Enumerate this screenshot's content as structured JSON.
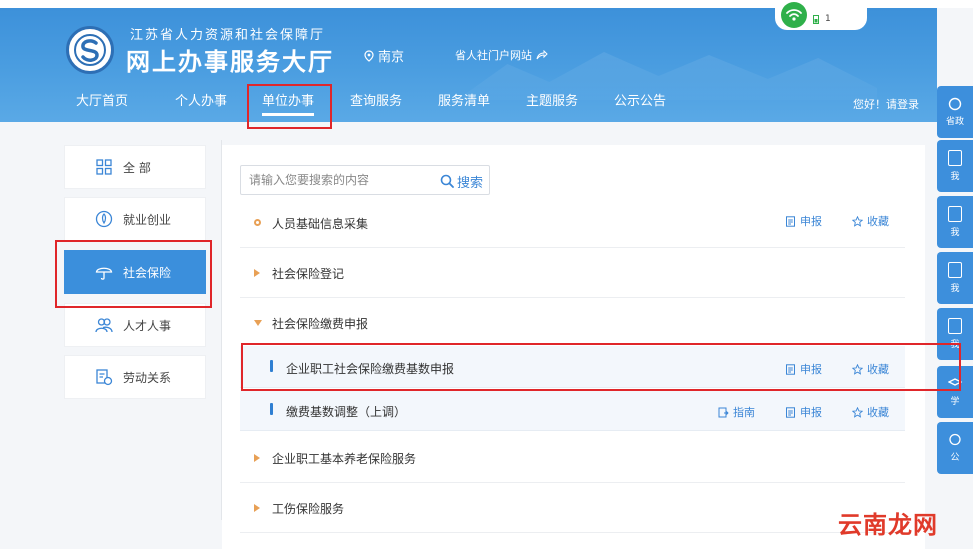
{
  "header": {
    "org_name": "江苏省人力资源和社会保障厅",
    "hall_name": "网上办事服务大厅",
    "city": "南京",
    "portal_link": "省人社门户网站",
    "signal_count": "1",
    "login_text": "您好！请登录"
  },
  "nav": {
    "items": [
      "大厅首页",
      "个人办事",
      "单位办事",
      "查询服务",
      "服务清单",
      "主题服务",
      "公示公告"
    ],
    "active_index": 2
  },
  "rightbar": {
    "items": [
      "省政",
      "我",
      "我",
      "我",
      "我",
      "学",
      "公"
    ]
  },
  "sidebar": {
    "items": [
      {
        "label": "全 部",
        "icon": "grid-icon"
      },
      {
        "label": "就业创业",
        "icon": "rocket-icon"
      },
      {
        "label": "社会保险",
        "icon": "umbrella-icon"
      },
      {
        "label": "人才人事",
        "icon": "people-icon"
      },
      {
        "label": "劳动关系",
        "icon": "contract-icon"
      }
    ],
    "active_index": 2
  },
  "search": {
    "placeholder": "请输入您要搜索的内容",
    "button_label": "搜索"
  },
  "services": [
    {
      "title": "人员基础信息采集",
      "type": "top",
      "marker": "ring",
      "declare": "申报",
      "favorite": "收藏"
    },
    {
      "title": "社会保险登记",
      "type": "top",
      "marker": "collapsed"
    },
    {
      "title": "社会保险缴费申报",
      "type": "top",
      "marker": "expanded"
    },
    {
      "title": "企业职工社会保险缴费基数申报",
      "type": "sub",
      "declare": "申报",
      "favorite": "收藏"
    },
    {
      "title": "缴费基数调整（上调）",
      "type": "sub",
      "guide": "指南",
      "declare": "申报",
      "favorite": "收藏"
    },
    {
      "title": "企业职工基本养老保险服务",
      "type": "top",
      "marker": "collapsed"
    },
    {
      "title": "工伤保险服务",
      "type": "top",
      "marker": "collapsed"
    }
  ],
  "watermark": "云南龙网",
  "colors": {
    "header_blue": "#4a9de0",
    "active_blue": "#3b8fdc",
    "link_blue": "#3b86d6",
    "marker_orange": "#e8a055",
    "highlight_red": "#e0262a"
  }
}
